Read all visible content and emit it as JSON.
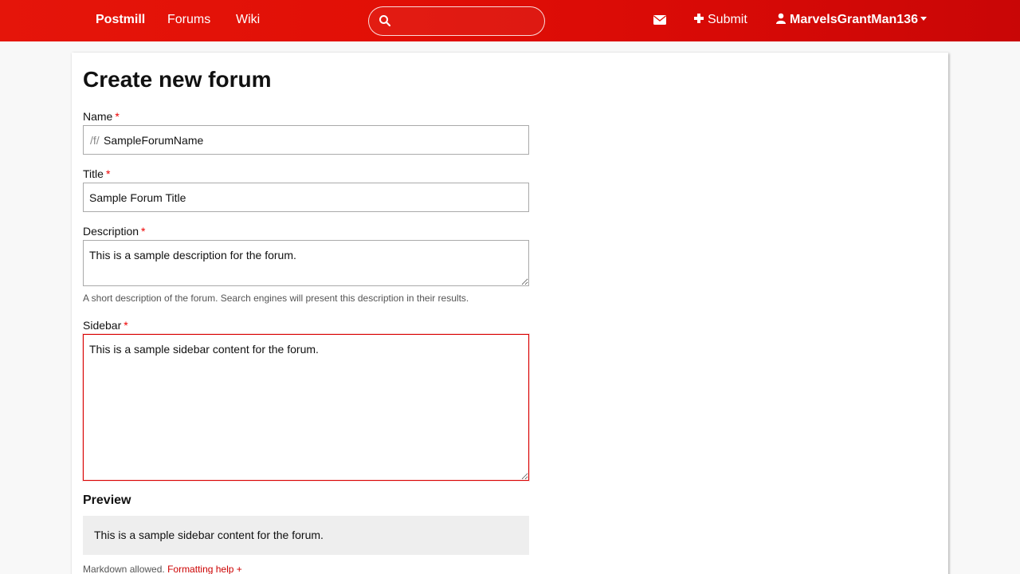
{
  "nav": {
    "brand": "Postmill",
    "forums": "Forums",
    "wiki": "Wiki",
    "search_value": "",
    "submit": "Submit",
    "username": "MarvelsGrantMan136"
  },
  "form": {
    "title": "Create new forum",
    "name": {
      "label": "Name",
      "required": "*",
      "prefix": "/f/",
      "value": "SampleForumName"
    },
    "forum_title": {
      "label": "Title",
      "required": "*",
      "value": "Sample Forum Title"
    },
    "description": {
      "label": "Description",
      "required": "*",
      "value": "This is a sample description for the forum.",
      "help": "A short description of the forum. Search engines will present this description in their results."
    },
    "sidebar": {
      "label": "Sidebar",
      "required": "*",
      "value": "This is a sample sidebar content for the forum."
    },
    "preview": {
      "heading": "Preview",
      "content": "This is a sample sidebar content for the forum."
    },
    "markdown_note": "Markdown allowed.",
    "formatting_help": "Formatting help +"
  },
  "colors": {
    "accent": "#e10f06",
    "required": "#ee0000",
    "link": "#cc0000"
  },
  "icons": [
    "search-icon",
    "envelope-icon",
    "plus-icon",
    "user-icon",
    "caret-down-icon"
  ]
}
